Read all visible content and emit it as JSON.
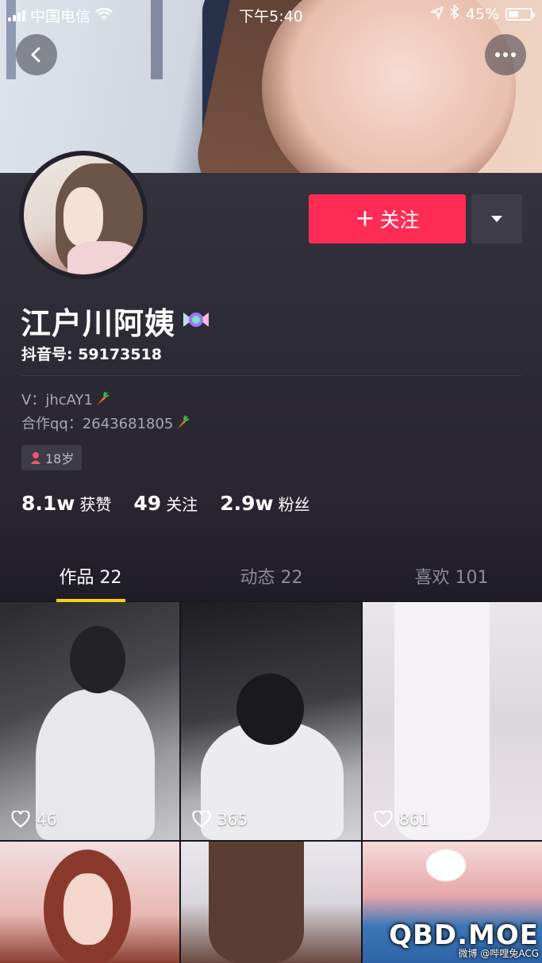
{
  "status_bar": {
    "carrier": "中国电信",
    "time": "下午5:40",
    "battery": "45%",
    "battery_level": 0.45
  },
  "profile": {
    "name": "江户川阿姨",
    "douyin_id": "抖音号: 59173518",
    "bio_line1": "V：jhcAY1",
    "bio_line2": "合作qq：2643681805",
    "age_tag": "18岁",
    "follow_label": "关注",
    "follow_plus": "+"
  },
  "stats": [
    {
      "value": "8.1w",
      "label": "获赞"
    },
    {
      "value": "49",
      "label": "关注"
    },
    {
      "value": "2.9w",
      "label": "粉丝"
    }
  ],
  "tabs": [
    {
      "label": "作品 22",
      "active": true
    },
    {
      "label": "动态 22",
      "active": false
    },
    {
      "label": "喜欢 101",
      "active": false
    }
  ],
  "videos": [
    {
      "likes": "46"
    },
    {
      "likes": "365"
    },
    {
      "likes": "861"
    }
  ],
  "watermark": {
    "title": "QBD.MOE",
    "subtitle": "微博 @哔哩兔ACG"
  },
  "colors": {
    "accent": "#fe2c55",
    "tab_indicator": "#face15",
    "background": "#17161f"
  },
  "icons": [
    "signal-icon",
    "wifi-icon",
    "location-icon",
    "bluetooth-icon",
    "battery-icon",
    "back-arrow-icon",
    "more-icon",
    "chevron-down-icon",
    "candy-icon",
    "carrot-icon",
    "female-icon",
    "heart-icon",
    "weibo-icon"
  ]
}
